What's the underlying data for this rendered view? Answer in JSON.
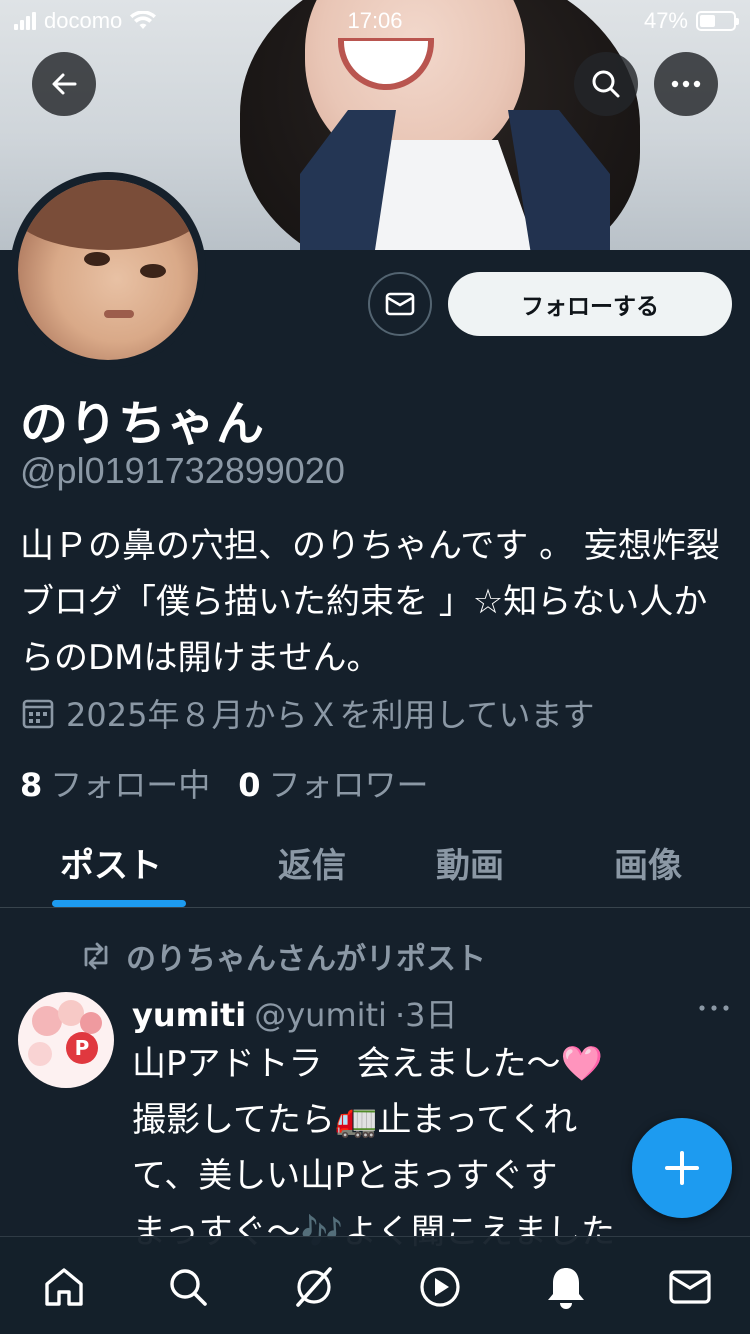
{
  "status_bar": {
    "carrier": "docomo",
    "time": "17:06",
    "battery_percent": "47%",
    "battery_level": 0.47
  },
  "header": {
    "back_icon": "arrow-left-icon",
    "search_icon": "search-icon",
    "more_icon": "more-horizontal-icon"
  },
  "profile": {
    "name": "のりちゃん",
    "handle": "@pl0191732899020",
    "bio": "山Ｐの鼻の穴担、のりちゃんです 。 妄想炸裂ブログ「僕ら描いた約束を 」☆知らない人からのDMは開けません。",
    "joined": "2025年８月からＸを利用しています",
    "following_count": "8",
    "following_label": "フォロー中",
    "followers_count": "0",
    "followers_label": "フォロワー",
    "follow_button": "フォローする",
    "dm_icon": "envelope-icon"
  },
  "tabs": [
    {
      "label": "ポスト",
      "active": true
    },
    {
      "label": "返信",
      "active": false
    },
    {
      "label": "動画",
      "active": false
    },
    {
      "label": "画像",
      "active": false
    }
  ],
  "post": {
    "repost_label": "のりちゃんさんがリポスト",
    "author_name": "yumiti",
    "author_handle": "@yumiti",
    "time": "·3日",
    "lines": [
      "山Pアドトラ　会えました〜🩷",
      "撮影してたら🚛止まってくれ",
      "て、美しい山Pとまっすぐす",
      "まっすぐ〜🎶よく聞こえました"
    ],
    "avatar_letter": "P"
  },
  "fab_icon": "plus-icon",
  "nav": [
    "home-icon",
    "search-icon",
    "grok-icon",
    "video-play-icon",
    "bell-icon",
    "mail-icon"
  ],
  "colors": {
    "background": "#15202b",
    "accent": "#1d9bf0",
    "muted": "#8b98a5"
  }
}
